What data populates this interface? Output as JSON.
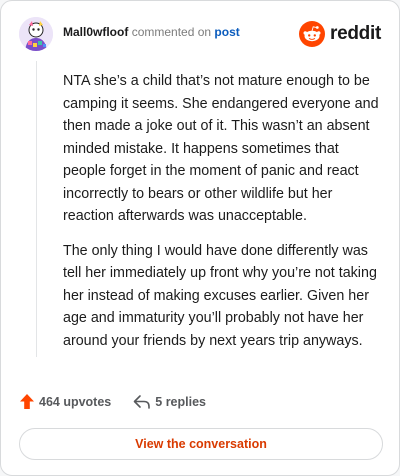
{
  "header": {
    "username": "Mall0wfloof",
    "commented_on": "commented on",
    "post_link": "post"
  },
  "brand": {
    "name": "reddit",
    "color": "#ff4500"
  },
  "comment": {
    "paragraphs": [
      "NTA she’s a child that’s not mature enough to be camping it seems. She endangered everyone and then made a joke out of it. This wasn’t an absent minded mistake. It happens sometimes that people forget in the moment of panic and react incorrectly to bears or other wildlife but her reaction afterwards was unacceptable.",
      "The only thing I would have done differently was tell her immediately up front why you’re not taking her instead of making excuses earlier. Given her age and immaturity you’ll probably not have her around your friends by next years trip anyways."
    ]
  },
  "actions": {
    "upvotes": "464 upvotes",
    "replies": "5 replies"
  },
  "cta": {
    "label": "View the conversation",
    "color": "#d93a00"
  },
  "icons": {
    "avatar": "user-avatar",
    "logo": "reddit-snoo-icon",
    "upvote": "upvote-arrow-icon",
    "reply": "reply-arrow-icon"
  }
}
